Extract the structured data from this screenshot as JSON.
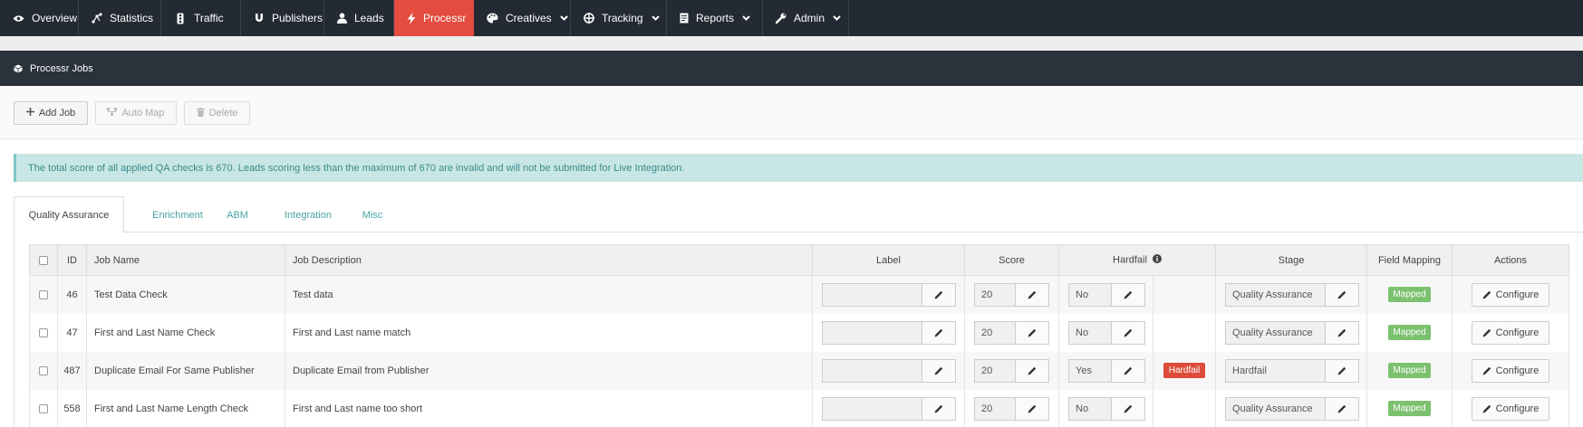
{
  "nav": {
    "items": [
      {
        "label": "Overview",
        "icon": "eye-icon"
      },
      {
        "label": "Statistics",
        "icon": "network-icon"
      },
      {
        "label": "Traffic",
        "icon": "traffic-light-icon"
      },
      {
        "label": "Publishers",
        "icon": "magnet-icon"
      },
      {
        "label": "Leads",
        "icon": "user-icon"
      },
      {
        "label": "Processr",
        "icon": "bolt-icon",
        "active": true
      },
      {
        "label": "Creatives",
        "icon": "palette-icon",
        "dropdown": true
      },
      {
        "label": "Tracking",
        "icon": "crosshair-icon",
        "dropdown": true
      },
      {
        "label": "Reports",
        "icon": "report-icon",
        "dropdown": true
      },
      {
        "label": "Admin",
        "icon": "wrench-icon",
        "dropdown": true
      }
    ]
  },
  "panel": {
    "title": "Processr Jobs"
  },
  "toolbar": {
    "add_label": "Add Job",
    "automap_label": "Auto Map",
    "delete_label": "Delete"
  },
  "alert": {
    "text": "The total score of all applied QA checks is 670. Leads scoring less than the maximum of 670 are invalid and will not be submitted for Live Integration."
  },
  "tabs": [
    "Quality Assurance",
    "Enrichment",
    "ABM",
    "Integration",
    "Misc"
  ],
  "table": {
    "headers": {
      "id": "ID",
      "name": "Job Name",
      "desc": "Job Description",
      "label": "Label",
      "score": "Score",
      "hardfail": "Hardfail",
      "stage": "Stage",
      "mapping": "Field Mapping",
      "actions": "Actions"
    },
    "rows": [
      {
        "id": "46",
        "name": "Test Data Check",
        "desc": "Test data",
        "label": "",
        "score": "20",
        "hardfail": "No",
        "hardfail_badge": "",
        "stage": "Quality Assurance",
        "mapping": "Mapped",
        "action": "Configure"
      },
      {
        "id": "47",
        "name": "First and Last Name Check",
        "desc": "First and Last name match",
        "label": "",
        "score": "20",
        "hardfail": "No",
        "hardfail_badge": "",
        "stage": "Quality Assurance",
        "mapping": "Mapped",
        "action": "Configure"
      },
      {
        "id": "487",
        "name": "Duplicate Email For Same Publisher",
        "desc": "Duplicate Email from Publisher",
        "label": "",
        "score": "20",
        "hardfail": "Yes",
        "hardfail_badge": "Hardfail",
        "stage": "Hardfail",
        "mapping": "Mapped",
        "action": "Configure"
      },
      {
        "id": "558",
        "name": "First and Last Name Length Check",
        "desc": "First and Last name too short",
        "label": "",
        "score": "20",
        "hardfail": "No",
        "hardfail_badge": "",
        "stage": "Quality Assurance",
        "mapping": "Mapped",
        "action": "Configure"
      }
    ]
  }
}
